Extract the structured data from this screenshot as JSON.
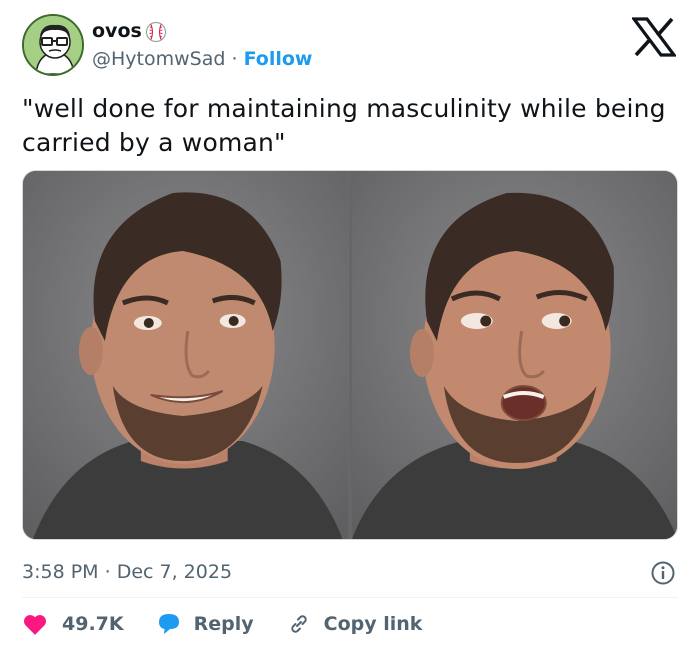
{
  "author": {
    "name": "ovos",
    "handle": "@HytomwSad",
    "separator": "·",
    "follow_label": "Follow"
  },
  "tweet": {
    "text": "\"well done for maintaining masculinity while being carried by a woman\""
  },
  "timestamp": {
    "time": "3:58 PM",
    "separator": "·",
    "date": "Dec 7, 2025"
  },
  "actions": {
    "likes_count": "49.7K",
    "reply_label": "Reply",
    "copy_link_label": "Copy link"
  },
  "icons": {
    "platform": "x-logo-icon",
    "like": "heart-icon",
    "reply": "reply-bubble-icon",
    "copy": "link-icon",
    "info": "info-icon",
    "badge": "baseball-icon"
  },
  "colors": {
    "accent": "#1d9bf0",
    "like": "#f91880",
    "text": "#0f1419",
    "secondary": "#536471"
  }
}
